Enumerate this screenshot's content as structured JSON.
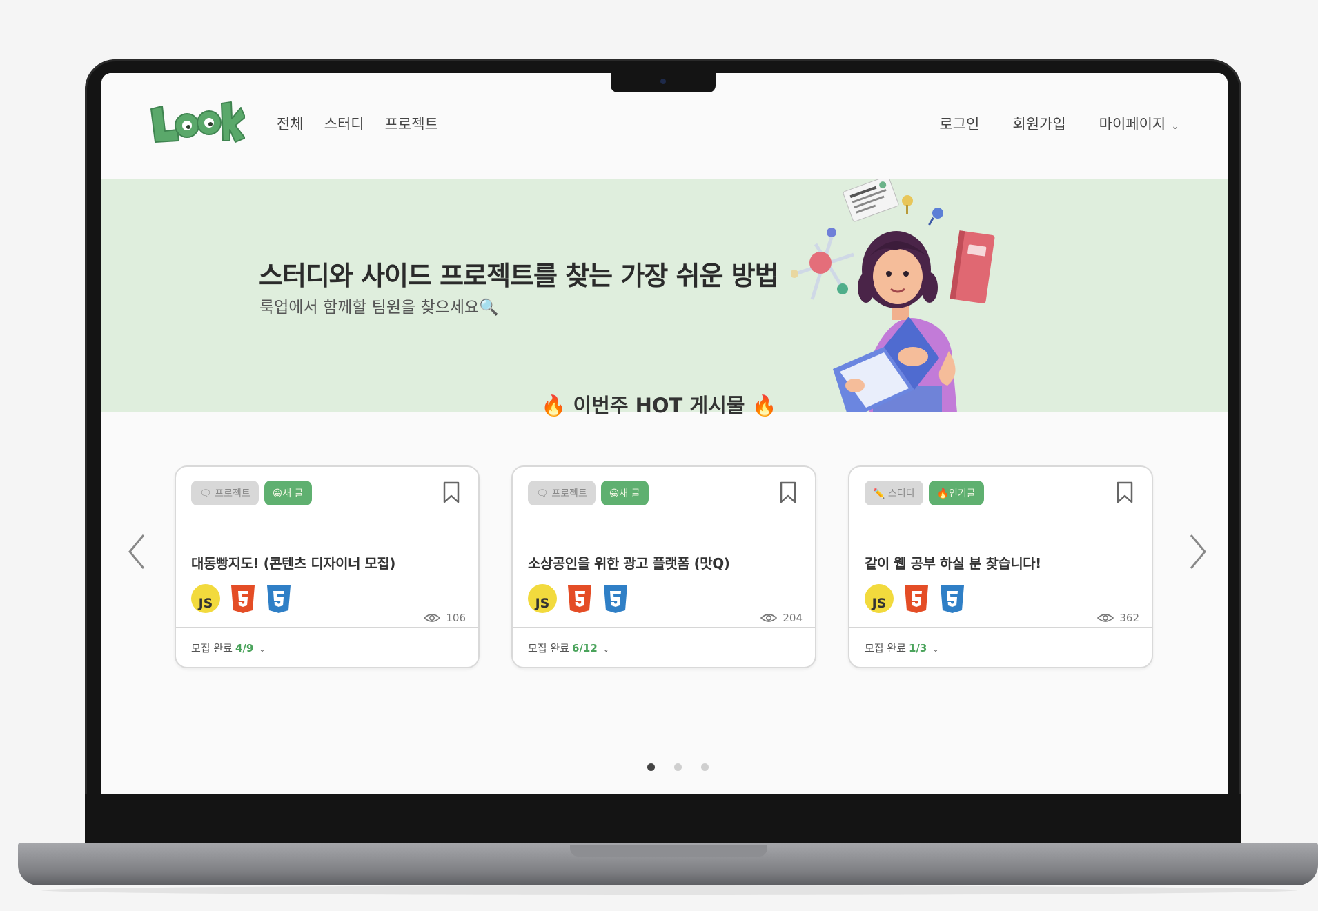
{
  "logo": {
    "text": "LOOK",
    "color": "#5aa86a"
  },
  "nav": {
    "left": [
      "전체",
      "스터디",
      "프로젝트"
    ],
    "login": "로그인",
    "signup": "회원가입",
    "mypage": "마이페이지",
    "mypage_chevron": "⌄"
  },
  "hero": {
    "title": "스터디와 사이드 프로젝트를 찾는 가장 쉬운 방법",
    "subtitle": "룩업에서 함께할 팀원을 찾으세요🔍",
    "background": "#dfeedd"
  },
  "hot": {
    "title": "🔥 이번주 HOT 게시물 🔥"
  },
  "cards": [
    {
      "tag_type": "🗨 프로젝트",
      "tag_status": "😀새 글",
      "title": "대동빵지도! (콘텐츠 디자이너 모집)",
      "stack": [
        "JS",
        "HTML5",
        "CSS3"
      ],
      "views": "106",
      "recruit_label": "모집 완료",
      "recruit_count": "4/9",
      "recruit_chevron": "⌄"
    },
    {
      "tag_type": "🗨 프로젝트",
      "tag_status": "😀새 글",
      "title": "소상공인을 위한 광고 플랫폼 (맛Q)",
      "stack": [
        "JS",
        "HTML5",
        "CSS3"
      ],
      "views": "204",
      "recruit_label": "모집 완료",
      "recruit_count": "6/12",
      "recruit_chevron": "⌄"
    },
    {
      "tag_type": "✏️ 스터디",
      "tag_status": "🔥인기글",
      "title": "같이 웹 공부 하실 분 찾습니다!",
      "stack": [
        "JS",
        "HTML5",
        "CSS3"
      ],
      "views": "362",
      "recruit_label": "모집 완료",
      "recruit_count": "1/3",
      "recruit_chevron": "⌄"
    }
  ],
  "carousel": {
    "active_page": 1,
    "pages": 3
  },
  "colors": {
    "accent_green": "#5fb070",
    "js_yellow": "#f2da3d",
    "html_orange": "#e44d26",
    "css_blue": "#2f7fc6"
  }
}
